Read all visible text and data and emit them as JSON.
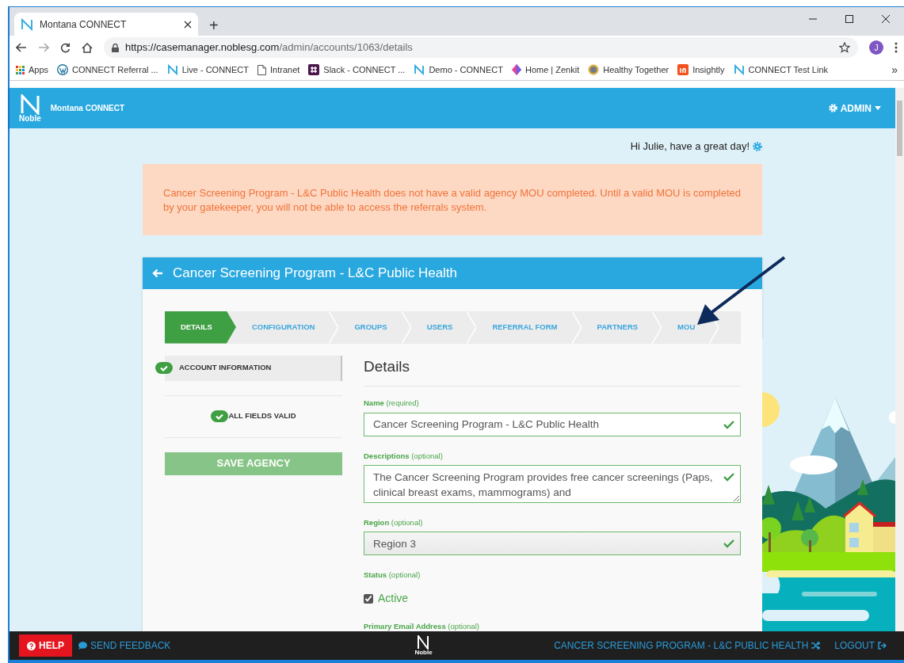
{
  "browser": {
    "tabs": [
      {
        "title": "Montana CONNECT",
        "selected": true
      }
    ],
    "new_tab": "+",
    "url": {
      "host": "https://casemanager.noblesg.com",
      "path": "/admin/accounts/1063/details"
    },
    "profile_initial": "J",
    "bookmarks": [
      {
        "label": "Apps",
        "kind": "grid"
      },
      {
        "label": "CONNECT Referral ...",
        "kind": "wordpress"
      },
      {
        "label": "Live - CONNECT",
        "kind": "noble"
      },
      {
        "label": "Intranet",
        "kind": "page"
      },
      {
        "label": "Slack - CONNECT ...",
        "kind": "slack"
      },
      {
        "label": "Demo - CONNECT",
        "kind": "noble"
      },
      {
        "label": "Home | Zenkit",
        "kind": "zenkit"
      },
      {
        "label": "Healthy Together",
        "kind": "seal"
      },
      {
        "label": "Insightly",
        "kind": "insightly"
      },
      {
        "label": "CONNECT Test Link",
        "kind": "noble"
      }
    ],
    "bookmarks_more": "»"
  },
  "app": {
    "brand": "Noble",
    "title": "Montana CONNECT",
    "admin_menu": "ADMIN"
  },
  "greeting": "Hi Julie, have a great day!",
  "alert": "Cancer Screening Program - L&C Public Health does not have a valid agency MOU completed. Until a valid MOU is completed by your gatekeeper, you will not be able to access the referrals system.",
  "account_card": {
    "title": "Cancer Screening Program - L&C Public Health",
    "steps": [
      {
        "label": "DETAILS",
        "selected": true
      },
      {
        "label": "CONFIGURATION",
        "selected": false
      },
      {
        "label": "GROUPS",
        "selected": false
      },
      {
        "label": "USERS",
        "selected": false
      },
      {
        "label": "REFERRAL FORM",
        "selected": false
      },
      {
        "label": "PARTNERS",
        "selected": false
      },
      {
        "label": "MOU",
        "selected": false
      }
    ],
    "sections": [
      {
        "label": "ACCOUNT INFORMATION",
        "valid": true,
        "selected": true
      }
    ],
    "validation": {
      "label": "ALL FIELDS VALID",
      "valid": true
    },
    "save_button": {
      "label": "SAVE AGENCY",
      "disabled": true
    },
    "form": {
      "heading": "Details",
      "fields": [
        {
          "kind": "input",
          "label": "Name",
          "hint": "(required)",
          "value": "Cancer Screening Program - L&C Public Health",
          "valid": true
        },
        {
          "kind": "textarea",
          "label": "Descriptions",
          "hint": "(optional)",
          "value": "The Cancer Screening Program provides free cancer screenings (Paps, clinical breast exams, mammograms) and",
          "valid": true
        },
        {
          "kind": "select",
          "label": "Region",
          "hint": "(optional)",
          "value": "Region 3",
          "valid": true
        },
        {
          "kind": "checkbox",
          "label": "Status",
          "hint": "(optional)",
          "option": "Active",
          "checked": true
        },
        {
          "kind": "input",
          "label": "Primary Email Address",
          "hint": "(optional)"
        }
      ]
    }
  },
  "footer": {
    "help": "HELP",
    "feedback": "SEND FEEDBACK",
    "brand": "Noble",
    "account": "CANCER SCREENING PROGRAM - L&C PUBLIC HEALTH",
    "logout": "LOGOUT"
  }
}
